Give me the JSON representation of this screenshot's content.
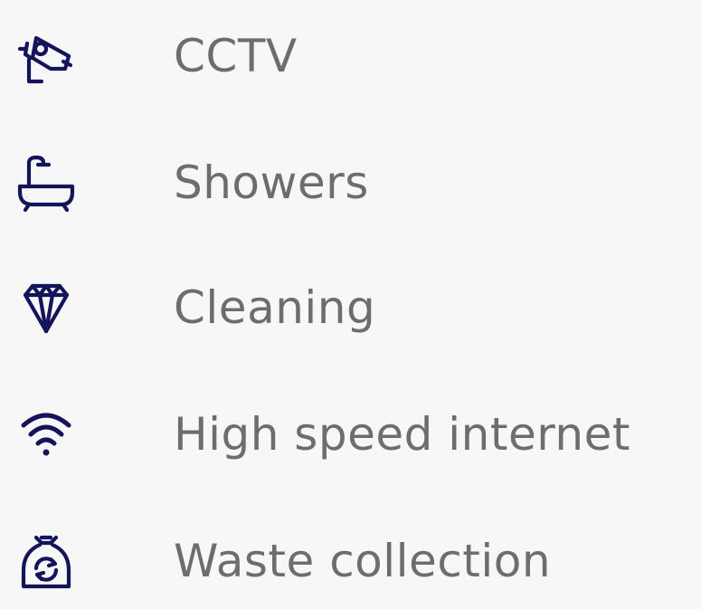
{
  "colors": {
    "background": "#f7f7f7",
    "icon": "#14145a",
    "text": "#6d6d6d"
  },
  "amenities": [
    {
      "icon": "cctv-camera-icon",
      "label": "CCTV"
    },
    {
      "icon": "bathtub-shower-icon",
      "label": "Showers"
    },
    {
      "icon": "diamond-icon",
      "label": "Cleaning"
    },
    {
      "icon": "wifi-icon",
      "label": "High speed internet"
    },
    {
      "icon": "recycling-bag-icon",
      "label": "Waste collection"
    }
  ]
}
